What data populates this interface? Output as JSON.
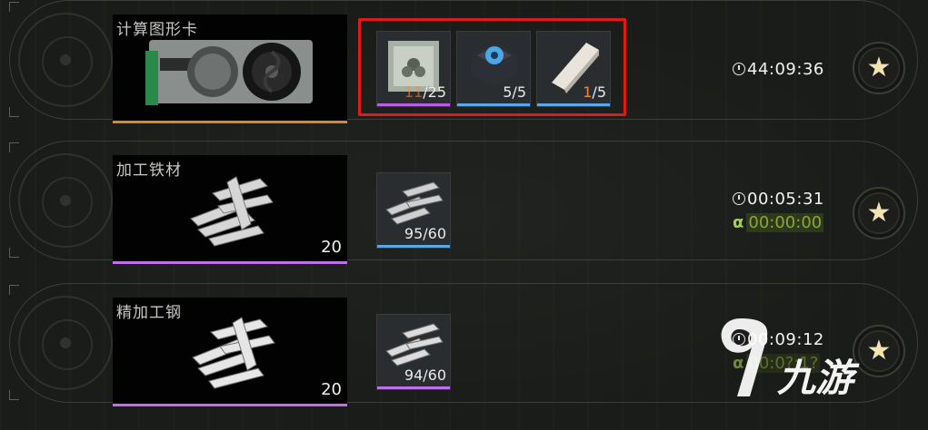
{
  "rows": [
    {
      "product_name": "计算图形卡",
      "product_count": "",
      "product_bar_color": "#d98a28",
      "timer": "44:09:36",
      "alpha_timer": "",
      "slots": [
        {
          "icon": "cpu-chip-icon",
          "count_cur": "11",
          "count_rest": "/25",
          "bar_color": "#b65fe0"
        },
        {
          "icon": "cooling-fan-icon",
          "count_cur": "5",
          "count_rest": "/5",
          "bar_color": "#5aa8e8"
        },
        {
          "icon": "metal-plate-icon",
          "count_cur": "1",
          "count_rest": "/5",
          "bar_color": "#5aa8e8"
        }
      ]
    },
    {
      "product_name": "加工铁材",
      "product_count": "20",
      "product_bar_color": "#c070e8",
      "timer": "00:05:31",
      "alpha_timer": "00:00:00",
      "slots": [
        {
          "icon": "iron-ingots-icon",
          "count_cur": "95",
          "count_rest": "/60",
          "bar_color": "#5aa8e8"
        }
      ]
    },
    {
      "product_name": "精加工钢",
      "product_count": "20",
      "product_bar_color": "#c070e8",
      "timer": "00:09:12",
      "alpha_timer": "00:0?:1?",
      "slots": [
        {
          "icon": "steel-bars-icon",
          "count_cur": "94",
          "count_rest": "/60",
          "bar_color": "#c070e8"
        }
      ]
    }
  ],
  "alpha_symbol": "α",
  "star_symbol": "★",
  "watermark": {
    "logo_text": "九游"
  }
}
